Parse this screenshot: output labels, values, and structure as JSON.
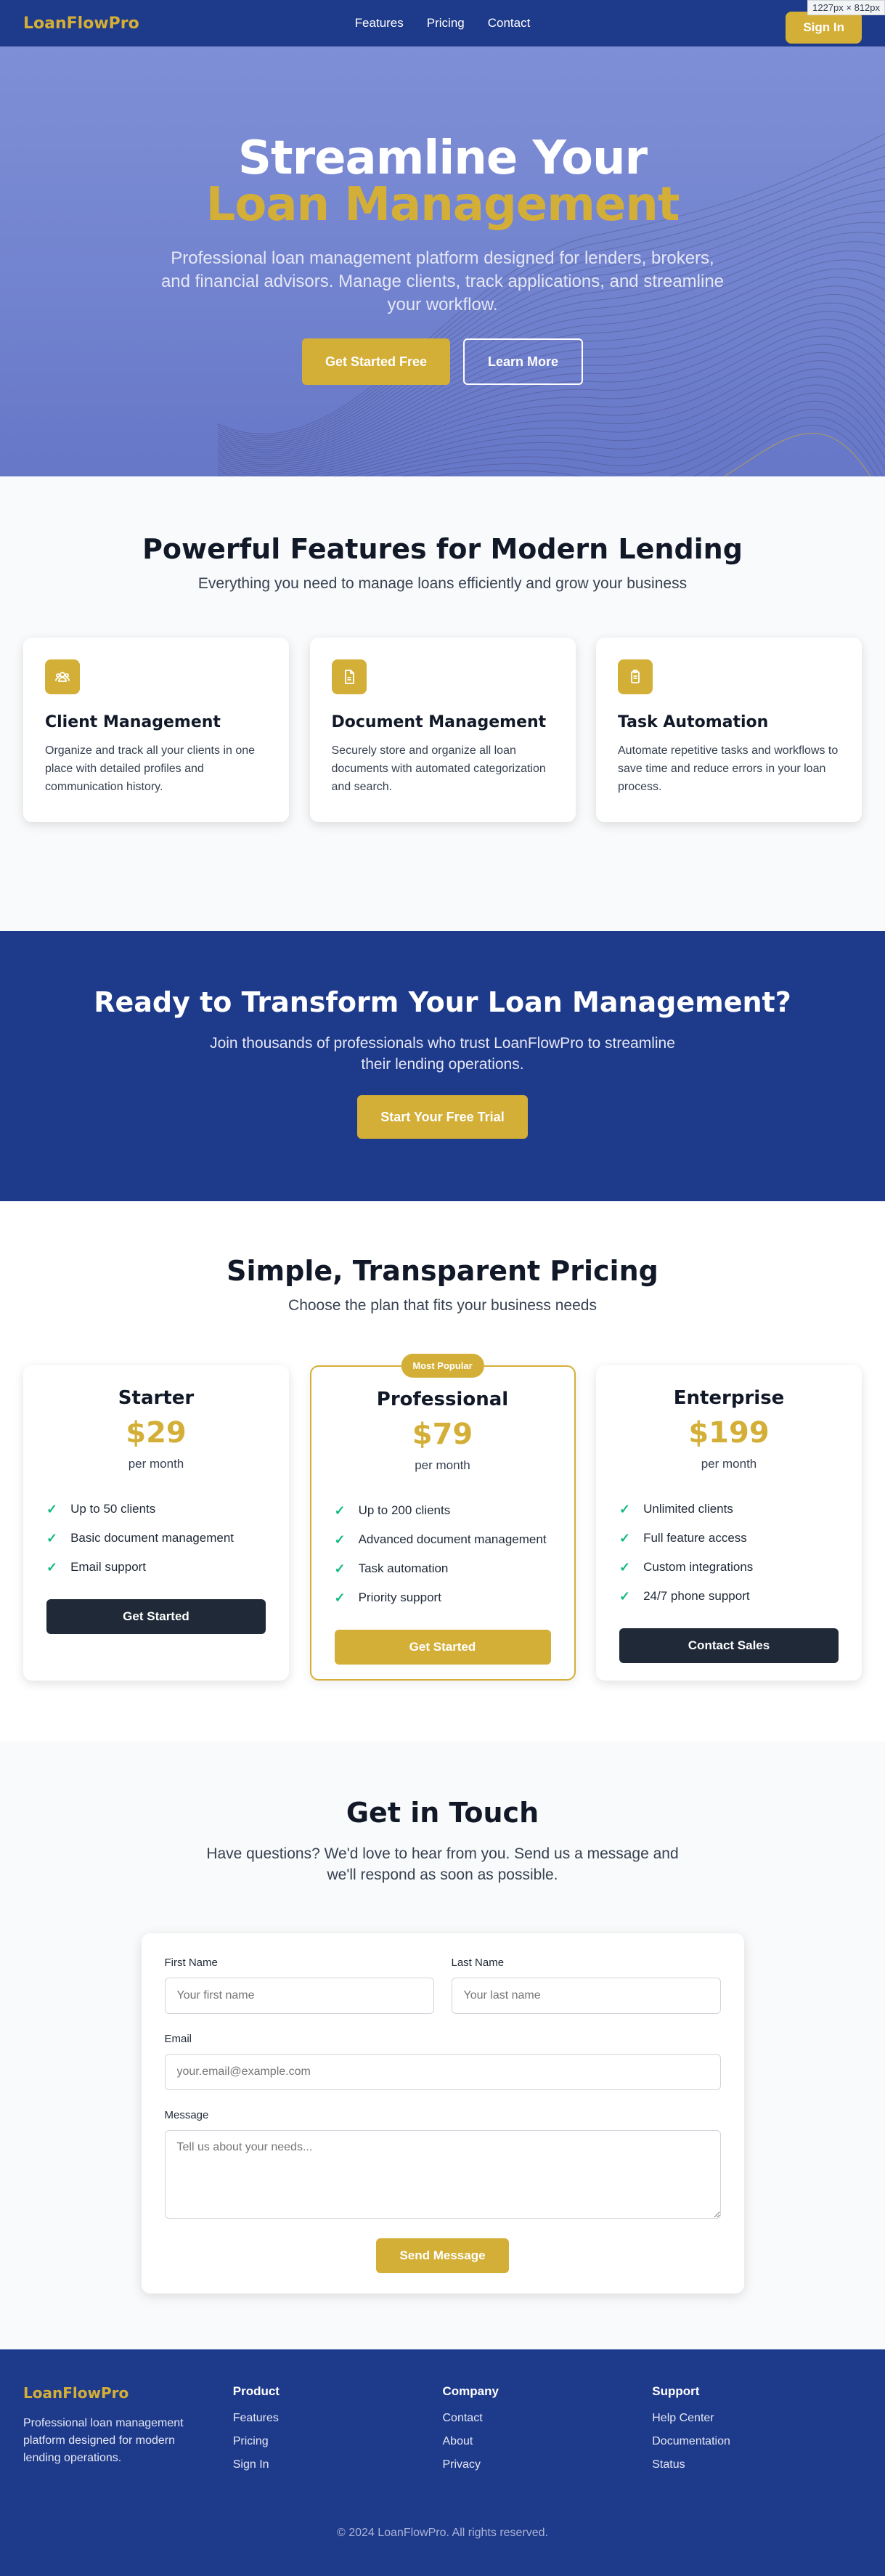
{
  "nav": {
    "logo": "LoanFlowPro",
    "links": [
      "Features",
      "Pricing",
      "Contact"
    ],
    "signin": "Sign In",
    "dimension_badge": "1227px × 812px"
  },
  "hero": {
    "title_line1": "Streamline Your",
    "title_line2": "Loan Management",
    "subtitle": "Professional loan management platform designed for lenders, brokers, and financial advisors. Manage clients, track applications, and streamline your workflow.",
    "primary_cta": "Get Started Free",
    "secondary_cta": "Learn More"
  },
  "features": {
    "title": "Powerful Features for Modern Lending",
    "subtitle": "Everything you need to manage loans efficiently and grow your business",
    "items": [
      {
        "icon": "users-icon",
        "title": "Client Management",
        "desc": "Organize and track all your clients in one place with detailed profiles and communication history."
      },
      {
        "icon": "document-icon",
        "title": "Document Management",
        "desc": "Securely store and organize all loan documents with automated categorization and search."
      },
      {
        "icon": "clipboard-icon",
        "title": "Task Automation",
        "desc": "Automate repetitive tasks and workflows to save time and reduce errors in your loan process."
      }
    ]
  },
  "cta": {
    "title": "Ready to Transform Your Loan Management?",
    "subtitle": "Join thousands of professionals who trust LoanFlowPro to streamline their lending operations.",
    "button": "Start Your Free Trial"
  },
  "pricing": {
    "title": "Simple, Transparent Pricing",
    "subtitle": "Choose the plan that fits your business needs",
    "badge": "Most Popular",
    "plans": [
      {
        "name": "Starter",
        "price": "$29",
        "period": "per month",
        "features": [
          "Up to 50 clients",
          "Basic document management",
          "Email support"
        ],
        "button": "Get Started"
      },
      {
        "name": "Professional",
        "price": "$79",
        "period": "per month",
        "features": [
          "Up to 200 clients",
          "Advanced document management",
          "Task automation",
          "Priority support"
        ],
        "button": "Get Started"
      },
      {
        "name": "Enterprise",
        "price": "$199",
        "period": "per month",
        "features": [
          "Unlimited clients",
          "Full feature access",
          "Custom integrations",
          "24/7 phone support"
        ],
        "button": "Contact Sales"
      }
    ]
  },
  "contact": {
    "title": "Get in Touch",
    "subtitle": "Have questions? We'd love to hear from you. Send us a message and we'll respond as soon as possible.",
    "first_name_label": "First Name",
    "first_name_placeholder": "Your first name",
    "last_name_label": "Last Name",
    "last_name_placeholder": "Your last name",
    "email_label": "Email",
    "email_placeholder": "your.email@example.com",
    "message_label": "Message",
    "message_placeholder": "Tell us about your needs...",
    "submit": "Send Message"
  },
  "footer": {
    "logo": "LoanFlowPro",
    "description": "Professional loan management platform designed for modern lending operations.",
    "product_title": "Product",
    "product_links": [
      "Features",
      "Pricing",
      "Sign In"
    ],
    "company_title": "Company",
    "company_links": [
      "Contact",
      "About",
      "Privacy"
    ],
    "support_title": "Support",
    "support_links": [
      "Help Center",
      "Documentation",
      "Status"
    ],
    "copyright": "© 2024 LoanFlowPro. All rights reserved."
  },
  "colors": {
    "brand_blue": "#1e3a8a",
    "gold": "#d4af37",
    "check_green": "#10b981"
  }
}
